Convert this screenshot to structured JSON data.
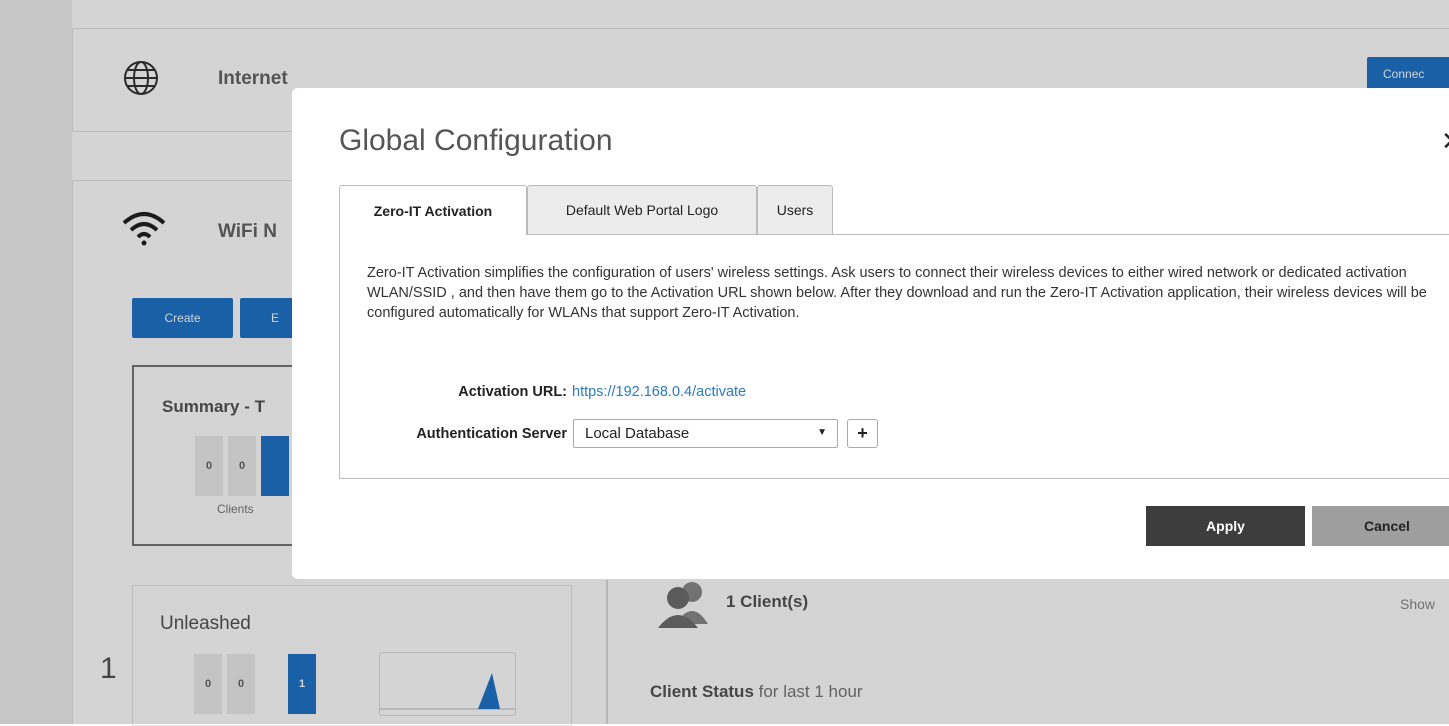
{
  "background": {
    "internet": {
      "title": "Internet",
      "connect_label": "Connec"
    },
    "wifi": {
      "title": "WiFi N",
      "create_label": "Create",
      "edit_label": "E"
    },
    "summary": {
      "title": "Summary - T",
      "tile_values": [
        "0",
        "0"
      ],
      "clients_label": "Clients"
    },
    "unleashed": {
      "title": "Unleashed",
      "number": "1",
      "tile_values": [
        "0",
        "0",
        "1"
      ]
    },
    "clients": {
      "count_label": "1 Client(s)",
      "show_label": "Show"
    },
    "client_status": {
      "bold": "Client Status",
      "rest": " for last 1 hour"
    }
  },
  "modal": {
    "title": "Global Configuration",
    "tabs": [
      {
        "label": "Zero-IT Activation",
        "active": true
      },
      {
        "label": "Default Web Portal Logo",
        "active": false
      },
      {
        "label": "Users",
        "active": false
      }
    ],
    "description": "Zero-IT Activation simplifies the configuration of users' wireless settings. Ask users to connect their wireless devices to either wired network or dedicated activation WLAN/SSID , and then have them go to the Activation URL shown below. After they download and run the Zero-IT Activation application, their wireless devices will be configured automatically for WLANs that support Zero-IT Activation.",
    "activation_url_label": "Activation URL:",
    "activation_url": "https://192.168.0.4/activate",
    "auth_server_label": "Authentication Server",
    "auth_server_value": "Local Database",
    "plus_label": "+",
    "apply_label": "Apply",
    "cancel_label": "Cancel"
  },
  "colors": {
    "accent": "#1f74c8",
    "link": "#2a7ac4",
    "apply_bg": "#3d3d3d",
    "cancel_bg": "#9e9e9e"
  }
}
